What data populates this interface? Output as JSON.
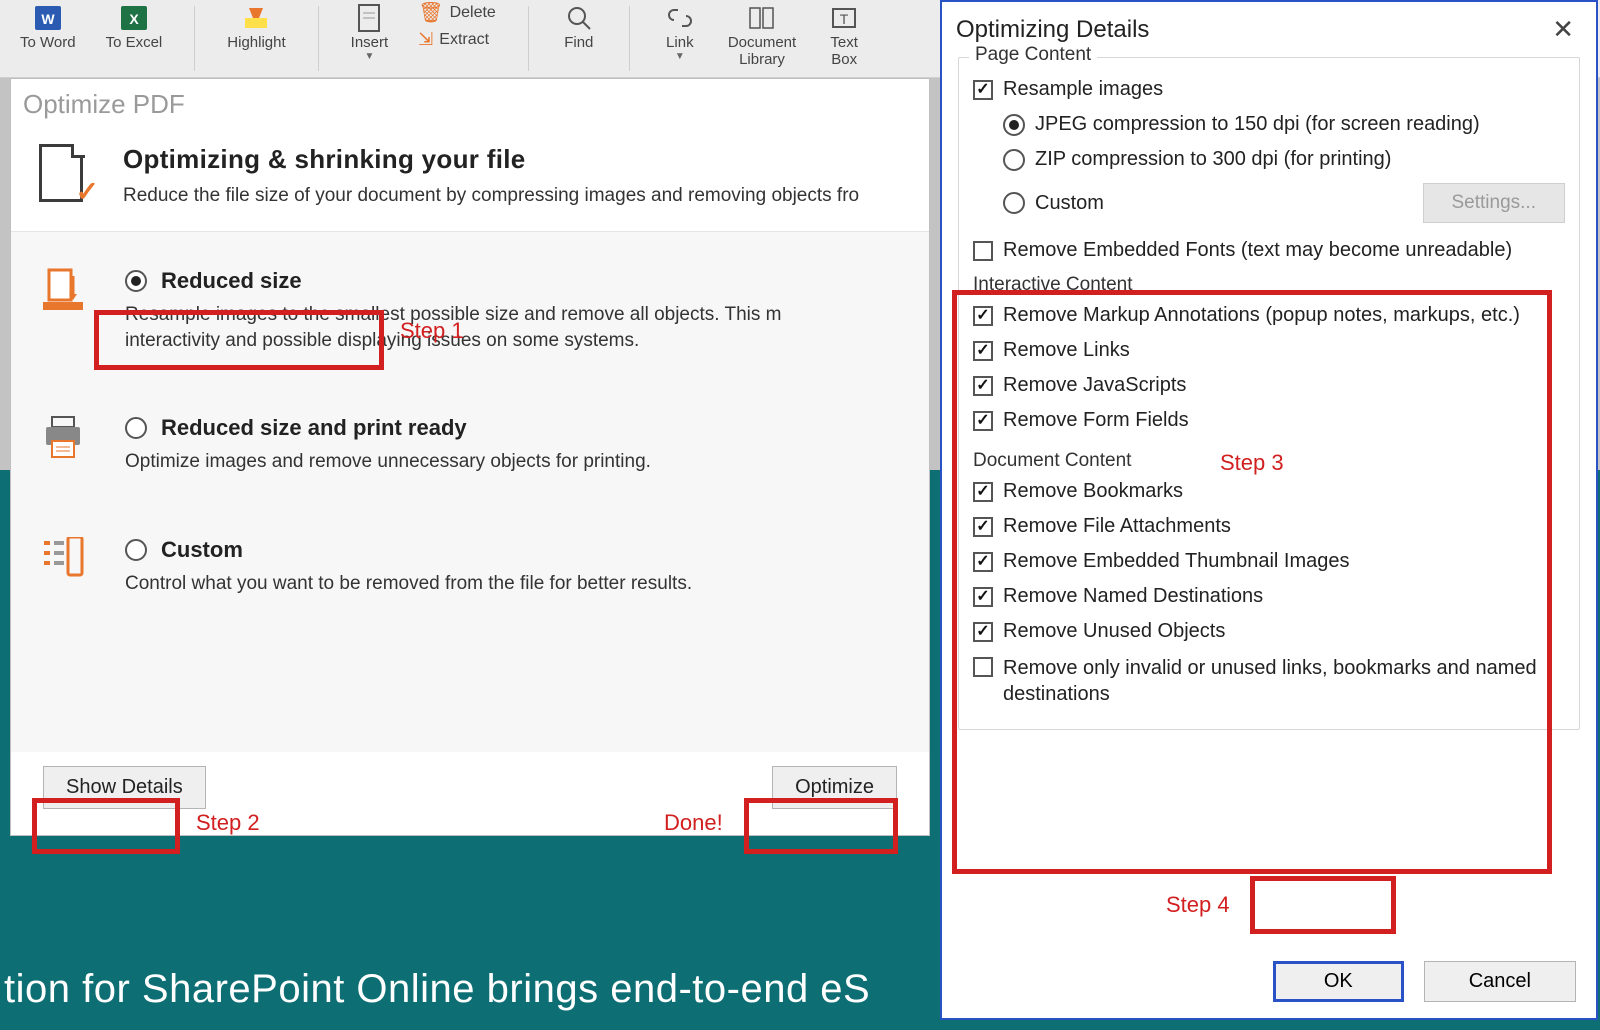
{
  "ribbon": {
    "to_word": "To Word",
    "to_excel": "To Excel",
    "highlight": "Highlight",
    "insert": "Insert",
    "delete": "Delete",
    "extract": "Extract",
    "find": "Find",
    "link": "Link",
    "doc_lib_l1": "Document",
    "doc_lib_l2": "Library",
    "textbox_l1": "Text",
    "textbox_l2": "Box"
  },
  "dlg1": {
    "window_title": "Optimize PDF",
    "heading": "Optimizing & shrinking your file",
    "subheading": "Reduce the file size of your document by compressing images and removing objects fro",
    "options": {
      "reduced": {
        "title": "Reduced size",
        "desc": "Resample images to the smallest possible size and remove all objects. This m interactivity and possible displaying issues on some systems."
      },
      "print": {
        "title": "Reduced size and print ready",
        "desc": "Optimize images and remove unnecessary objects for printing."
      },
      "custom": {
        "title": "Custom",
        "desc": "Control what you want to be removed from the file for better results."
      }
    },
    "show_details": "Show Details",
    "optimize": "Optimize"
  },
  "annotations": {
    "step1": "Step 1",
    "step2": "Step 2",
    "done": "Done!",
    "step3": "Step 3",
    "step4": "Step 4"
  },
  "dlg2": {
    "title": "Optimizing Details",
    "page_content": "Page Content",
    "resample": "Resample images",
    "jpeg": "JPEG compression to 150 dpi (for screen reading)",
    "zip": "ZIP compression to 300 dpi (for printing)",
    "custom_comp": "Custom",
    "settings": "Settings...",
    "remove_fonts": "Remove Embedded Fonts (text may become unreadable)",
    "interactive": "Interactive Content",
    "remove_markup": "Remove Markup Annotations (popup notes, markups, etc.)",
    "remove_links": "Remove Links",
    "remove_js": "Remove JavaScripts",
    "remove_forms": "Remove Form Fields",
    "doc_content": "Document Content",
    "remove_bookmarks": "Remove Bookmarks",
    "remove_attach": "Remove File Attachments",
    "remove_thumbs": "Remove Embedded Thumbnail Images",
    "remove_dest": "Remove Named Destinations",
    "remove_unused": "Remove Unused Objects",
    "remove_invalid": "Remove only invalid or unused links, bookmarks and named destinations",
    "ok": "OK",
    "cancel": "Cancel"
  },
  "bg_text": "tion for SharePoint Online brings end-to-end eS"
}
